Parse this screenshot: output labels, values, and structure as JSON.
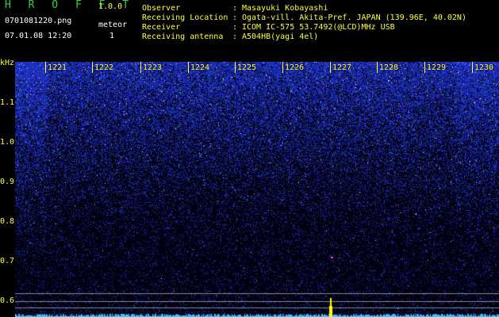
{
  "header": {
    "app_title": "H R O F F T",
    "app_version": "1.0.0",
    "file_name": "0701081220.png",
    "meteor_label": "meteor",
    "datetime": "07.01.08 12:20",
    "meteor_count": "1"
  },
  "info": [
    {
      "key": "Observer",
      "value": "Masayuki Kobayashi"
    },
    {
      "key": "Receiving Location",
      "value": "Ogata-vill. Akita-Pref. JAPAN (139.96E, 40.02N)"
    },
    {
      "key": "Receiver",
      "value": "ICOM IC-575 53.7492(@LCD)MHz USB"
    },
    {
      "key": "Receiving antenna",
      "value": "A504HB(yagi 4el)"
    }
  ],
  "info_separator": ":",
  "yaxis": {
    "unit": "kHz",
    "ticks": [
      "1.1",
      "1.0",
      "0.9",
      "0.8",
      "0.7",
      "0.6"
    ]
  },
  "xaxis": {
    "ticks": [
      "1221",
      "1222",
      "1223",
      "1224",
      "1225",
      "1226",
      "1227",
      "1228",
      "1229",
      "1230"
    ]
  },
  "colors": {
    "title": "#2fd14a",
    "labels": "#ffff33",
    "noise": "#1a2bd8",
    "meteor": "#ffff00",
    "baseline": "#39c6ff"
  }
}
